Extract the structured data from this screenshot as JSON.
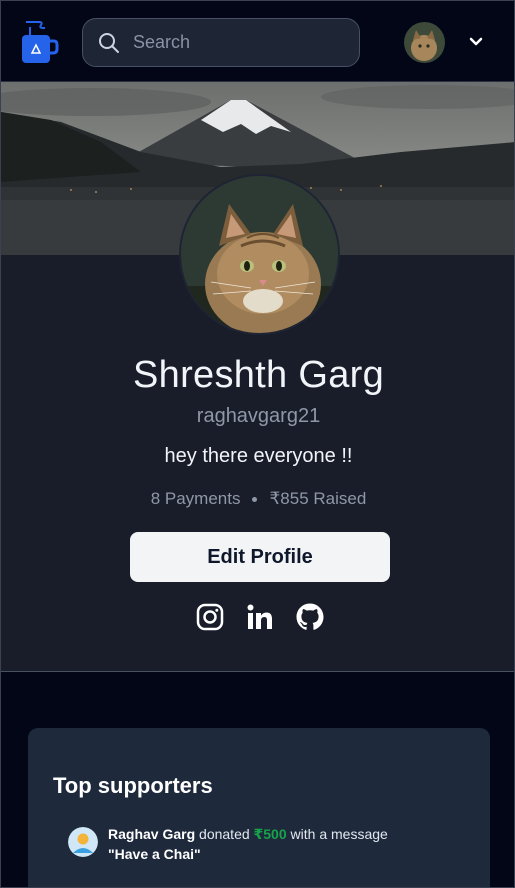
{
  "header": {
    "search_placeholder": "Search",
    "logo_icon": "chai-cup-icon",
    "user_menu_icon": "chevron-down-icon"
  },
  "profile": {
    "name": "Shreshth Garg",
    "username": "raghavgarg21",
    "bio": "hey there everyone !!",
    "payments": "8 Payments",
    "raised": "₹855 Raised",
    "edit_button": "Edit Profile"
  },
  "socials": [
    {
      "icon": "instagram-icon"
    },
    {
      "icon": "linkedin-icon"
    },
    {
      "icon": "github-icon"
    }
  ],
  "supporters": {
    "title": "Top supporters",
    "items": [
      {
        "name": "Raghav Garg",
        "verb": " donated ",
        "amount": "₹500",
        "suffix": " with a message",
        "message": "\"Have a Chai\""
      }
    ]
  },
  "colors": {
    "accent_green": "#16a34a",
    "card_bg": "#1e293b",
    "header_bg": "#020617",
    "logo_blue": "#2563eb"
  }
}
